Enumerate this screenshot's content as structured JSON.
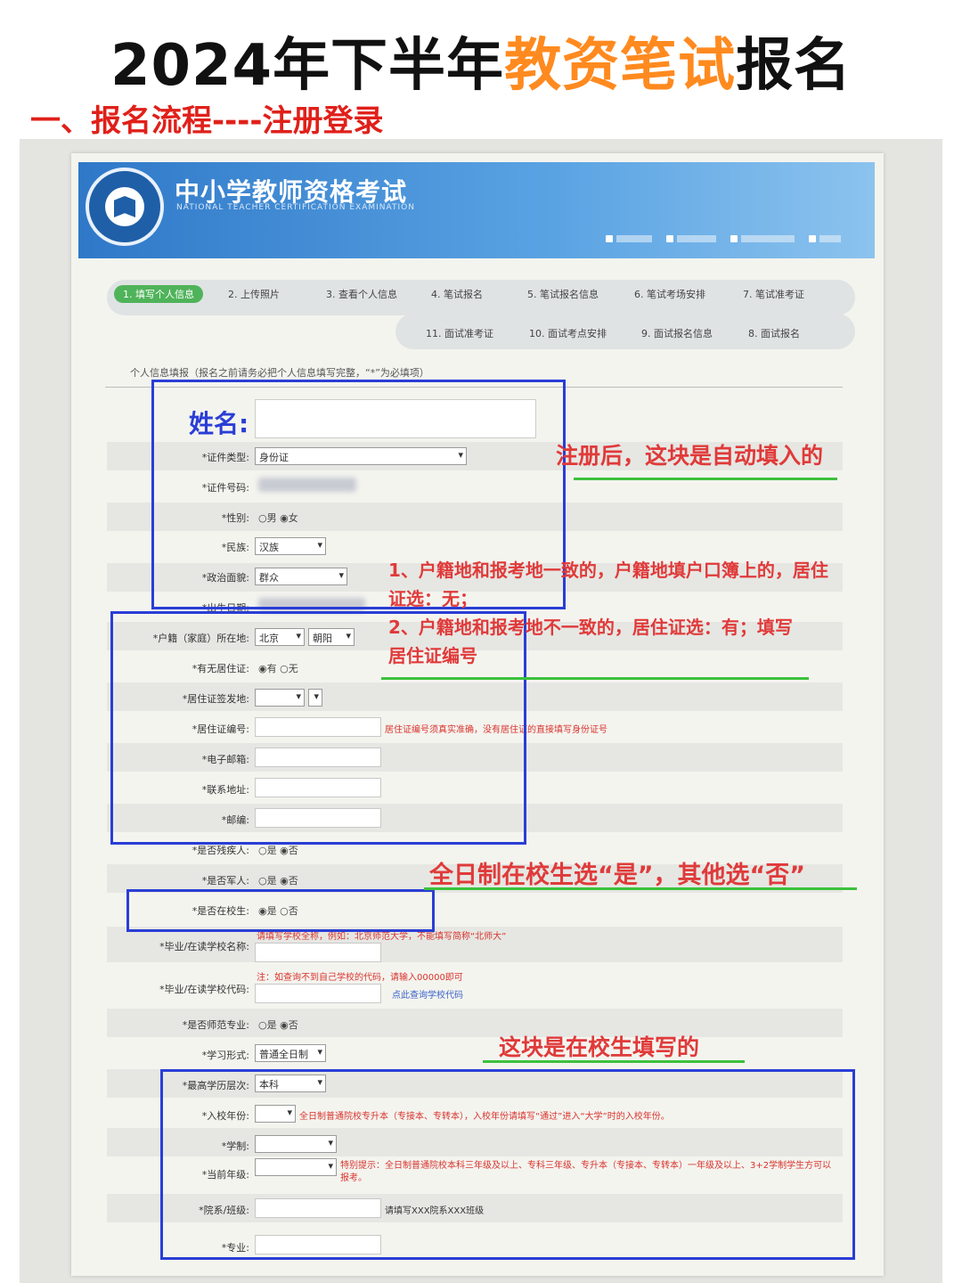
{
  "header": {
    "title_pre": "2024年下半年",
    "title_highlight": "教资笔试",
    "title_post": "报名",
    "subtitle": "一、报名流程----注册登录"
  },
  "site": {
    "name": "中小学教师资格考试",
    "name_en": "NATIONAL TEACHER CERTIFICATION EXAMINATION",
    "links": [
      "",
      "",
      "",
      ""
    ]
  },
  "steps": [
    "1. 填写个人信息",
    "2. 上传照片",
    "3. 查看个人信息",
    "4. 笔试报名",
    "5. 笔试报名信息",
    "6. 笔试考场安排",
    "7. 笔试准考证",
    "11. 面试准考证",
    "10. 面试考点安排",
    "9. 面试报名信息",
    "8. 面试报名"
  ],
  "form": {
    "section_head": "个人信息填报（报名之前请务必把个人信息填写完整，“*”为必填项）",
    "name_label": "姓名:",
    "fields": [
      {
        "label": "*证件类型:",
        "value": "身份证"
      },
      {
        "label": "*证件号码:",
        "value": ""
      },
      {
        "label": "*性别:",
        "value": "○男 ◉女"
      },
      {
        "label": "*民族:",
        "value": "汉族"
      },
      {
        "label": "*政治面貌:",
        "value": "群众"
      },
      {
        "label": "*出生日期:",
        "value": ""
      },
      {
        "label": "*户籍（家庭）所在地:",
        "value": "北京",
        "value2": "朝阳"
      },
      {
        "label": "*有无居住证:",
        "value": "◉有 ○无"
      },
      {
        "label": "*居住证签发地:",
        "value": ""
      },
      {
        "label": "*居住证编号:",
        "value": ""
      },
      {
        "label": "*电子邮箱:",
        "value": ""
      },
      {
        "label": "*联系地址:",
        "value": ""
      },
      {
        "label": "*邮编:",
        "value": ""
      },
      {
        "label": "*是否残疾人:",
        "value": "○是 ◉否"
      },
      {
        "label": "*是否军人:",
        "value": "○是 ◉否"
      },
      {
        "label": "*是否在校生:",
        "value": "◉是 ○否"
      },
      {
        "label": "*毕业/在读学校名称:",
        "value": ""
      },
      {
        "label": "*毕业/在读学校代码:",
        "value": ""
      },
      {
        "label": "*是否师范专业:",
        "value": "○是 ◉否"
      },
      {
        "label": "*学习形式:",
        "value": "普通全日制"
      },
      {
        "label": "*最高学历层次:",
        "value": "本科"
      },
      {
        "label": "*入校年份:",
        "value": ""
      },
      {
        "label": "*学制:",
        "value": ""
      },
      {
        "label": "*当前年级:",
        "value": ""
      },
      {
        "label": "*院系/班级:",
        "value": ""
      },
      {
        "label": "*专业:",
        "value": ""
      }
    ],
    "notes": {
      "residence_permit": "居住证编号须真实准确，没有居住证的直接填写身份证号",
      "school_name": "请填写学校全称，例如：北京师范大学，不能填写简称“北师大”",
      "school_code": "注：如查询不到自己学校的代码，请输入00000即可",
      "school_code_link": "点此查询学校代码",
      "entry_year": "全日制普通院校专升本（专接本、专转本），入校年份请填写“通过”进入“大学”时的入校年份。",
      "grade": "特别提示：全日制普通院校本科三年级及以上、专科三年级、专升本（专接本、专转本）一年级及以上、3+2学制学生方可以报考。",
      "class": "请填写XXX院系XXX班级"
    }
  },
  "annotations": {
    "auto_fill": "注册后，这块是自动填入的",
    "household_1": "1、户籍地和报考地一致的，户籍地填户口簿上的，居住证选：无；",
    "household_2": "2、户籍地和报考地不一致的，居住证选：有；填写居住证编号",
    "student_choice": "全日制在校生选“是”，其他选“否”",
    "student_fill": "这块是在校生填写的"
  },
  "colors": {
    "highlight": "#ff8a1f",
    "subtitle": "#e0201a",
    "annotation": "#e03a3a",
    "box": "#2a3ed6",
    "underline": "#3cc13c"
  }
}
